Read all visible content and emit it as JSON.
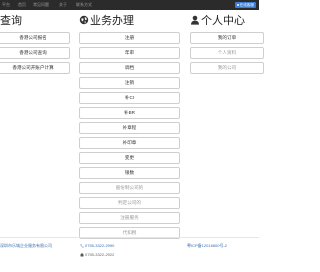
{
  "navbar": {
    "brand": "平台",
    "items": [
      "首页",
      "常见问题",
      "关于",
      "联系方式"
    ],
    "badge_label": "在线客服"
  },
  "columns": {
    "left": {
      "title": "查询",
      "buttons": [
        "香港公司报名",
        "香港公司查询",
        "香港公司开账户计算"
      ]
    },
    "middle": {
      "title": "业务办理",
      "buttons": [
        {
          "label": "注册",
          "muted": false
        },
        {
          "label": "年审",
          "muted": false
        },
        {
          "label": "调档",
          "muted": false
        },
        {
          "label": "注销",
          "muted": false
        },
        {
          "label": "补CI",
          "muted": false
        },
        {
          "label": "补BR",
          "muted": false
        },
        {
          "label": "补章程",
          "muted": false
        },
        {
          "label": "补印章",
          "muted": false
        },
        {
          "label": "变更",
          "muted": false
        },
        {
          "label": "银数",
          "muted": false
        },
        {
          "label": "股份制公司的",
          "muted": true
        },
        {
          "label": "判定公司的",
          "muted": true
        },
        {
          "label": "注册服务",
          "muted": true
        },
        {
          "label": "代扣税",
          "muted": true
        }
      ]
    },
    "right": {
      "title": "个人中心",
      "buttons": [
        {
          "label": "我的订单",
          "muted": false
        },
        {
          "label": "个人资料",
          "muted": true
        },
        {
          "label": "我的公司",
          "muted": true
        }
      ]
    }
  },
  "footer": {
    "company": "深圳市乐城企业服务有限公司",
    "phone1": "0755-3322-2990",
    "phone2": "0755-3322-2922",
    "icp": "粤ICP备12016800号-2"
  },
  "colors": {
    "navbar_bg": "#2b2b2b",
    "link_blue": "#3a6fb0",
    "badge_blue": "#3a7bd5"
  }
}
